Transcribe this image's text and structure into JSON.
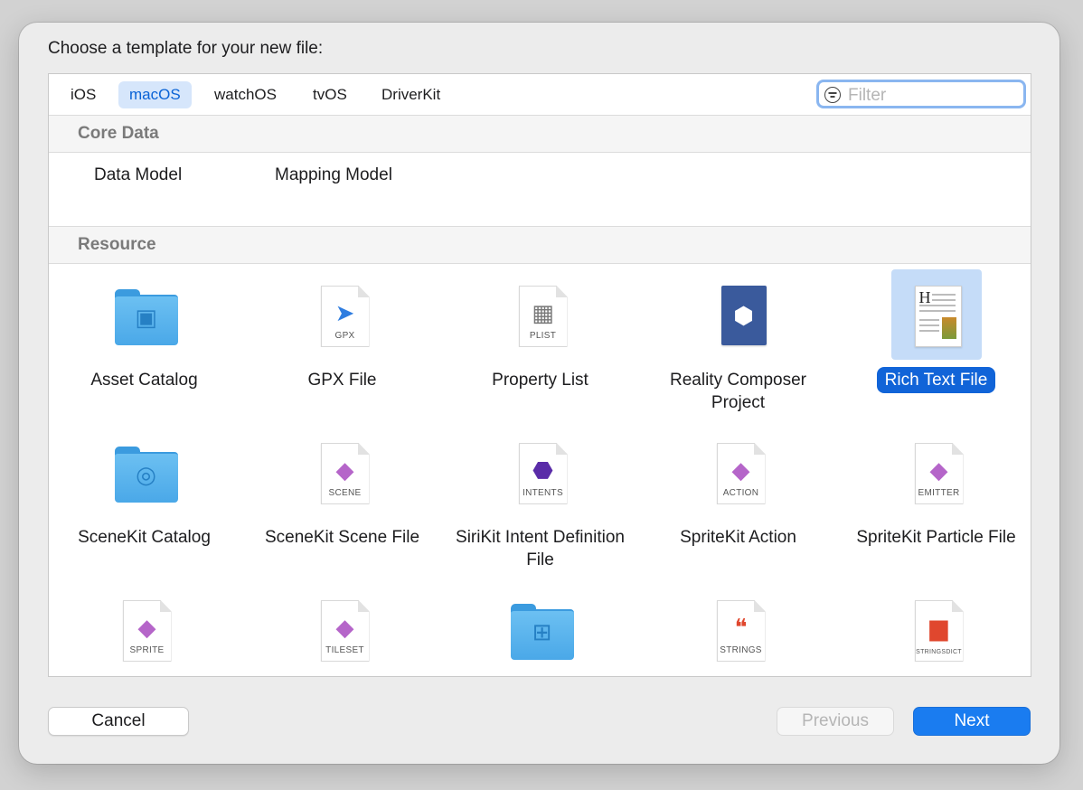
{
  "dialog": {
    "prompt": "Choose a template for your new file:"
  },
  "platform_tabs": [
    {
      "label": "iOS",
      "selected": false
    },
    {
      "label": "macOS",
      "selected": true
    },
    {
      "label": "watchOS",
      "selected": false
    },
    {
      "label": "tvOS",
      "selected": false
    },
    {
      "label": "DriverKit",
      "selected": false
    }
  ],
  "filter": {
    "placeholder": "Filter",
    "value": ""
  },
  "sections": {
    "core_data": {
      "title": "Core Data",
      "items": [
        "Data Model",
        "Mapping Model"
      ]
    },
    "resource": {
      "title": "Resource",
      "items": [
        {
          "label": "Asset Catalog",
          "icon": "asset-catalog-folder-icon"
        },
        {
          "label": "GPX File",
          "icon": "gpx-file-icon",
          "tag": "GPX"
        },
        {
          "label": "Property List",
          "icon": "property-list-icon",
          "tag": "PLIST"
        },
        {
          "label": "Reality Composer Project",
          "icon": "reality-composer-icon"
        },
        {
          "label": "Rich Text File",
          "icon": "rich-text-file-icon",
          "selected": true
        },
        {
          "label": "SceneKit Catalog",
          "icon": "scenekit-catalog-folder-icon"
        },
        {
          "label": "SceneKit Scene File",
          "icon": "scenekit-scene-icon",
          "tag": "SCENE"
        },
        {
          "label": "SiriKit Intent Definition File",
          "icon": "sirikit-intents-icon",
          "tag": "INTENTS"
        },
        {
          "label": "SpriteKit Action",
          "icon": "spritekit-action-icon",
          "tag": "ACTION"
        },
        {
          "label": "SpriteKit Particle File",
          "icon": "spritekit-emitter-icon",
          "tag": "EMITTER"
        },
        {
          "label": "",
          "icon": "spritekit-sprite-icon",
          "tag": "SPRITE"
        },
        {
          "label": "",
          "icon": "spritekit-tileset-icon",
          "tag": "TILESET"
        },
        {
          "label": "",
          "icon": "folder-grid-icon"
        },
        {
          "label": "",
          "icon": "strings-file-icon",
          "tag": "STRINGS"
        },
        {
          "label": "",
          "icon": "stringsdict-file-icon",
          "tag": "STRINGSDICT"
        }
      ]
    }
  },
  "buttons": {
    "cancel": "Cancel",
    "previous": "Previous",
    "next": "Next"
  }
}
